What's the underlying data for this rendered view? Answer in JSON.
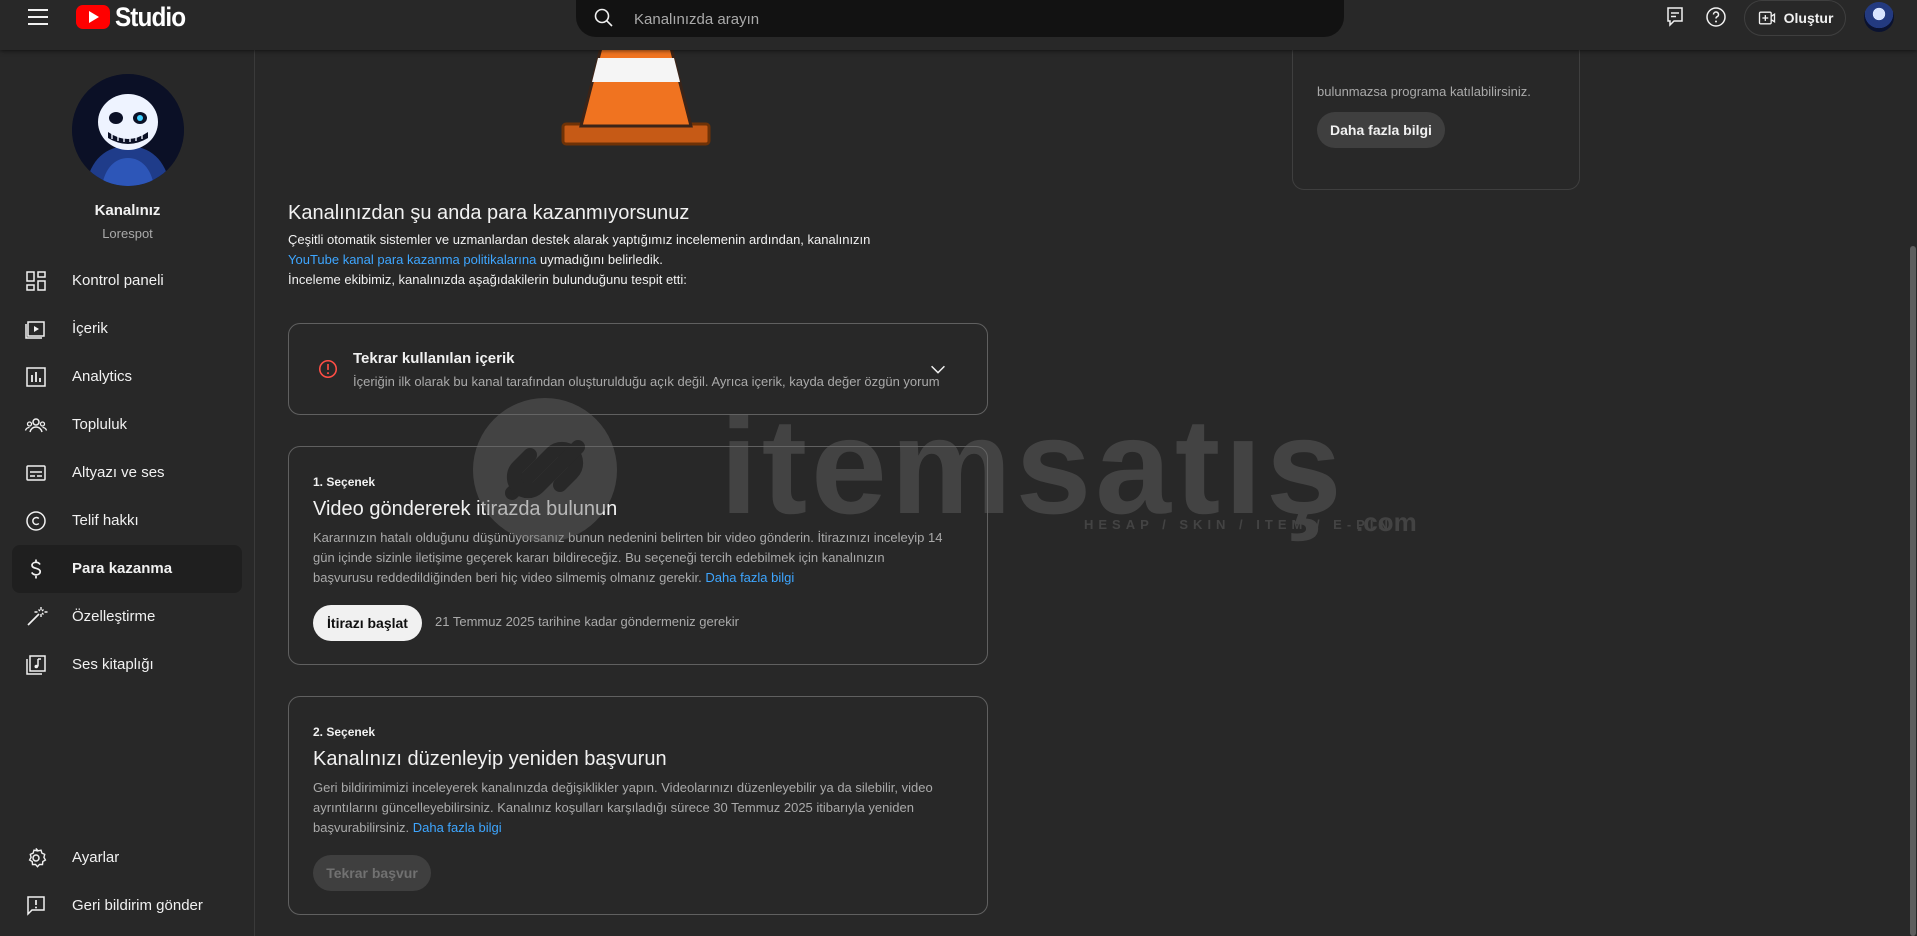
{
  "header": {
    "logo_text": "Studio",
    "search_placeholder": "Kanalınızda arayın",
    "create_label": "Oluştur"
  },
  "sidebar": {
    "channel_name": "Kanalınız",
    "channel_handle": "Lorespot",
    "items": [
      {
        "label": "Kontrol paneli",
        "icon": "dashboard-icon"
      },
      {
        "label": "İçerik",
        "icon": "content-icon"
      },
      {
        "label": "Analytics",
        "icon": "analytics-icon"
      },
      {
        "label": "Topluluk",
        "icon": "community-icon"
      },
      {
        "label": "Altyazı ve ses",
        "icon": "subtitles-icon"
      },
      {
        "label": "Telif hakkı",
        "icon": "copyright-icon"
      },
      {
        "label": "Para kazanma",
        "icon": "dollar-icon",
        "active": true
      },
      {
        "label": "Özelleştirme",
        "icon": "magic-wand-icon"
      },
      {
        "label": "Ses kitaplığı",
        "icon": "audio-library-icon"
      }
    ],
    "bottom_items": [
      {
        "label": "Ayarlar",
        "icon": "gear-icon"
      },
      {
        "label": "Geri bildirim gönder",
        "icon": "feedback-icon"
      }
    ]
  },
  "side_card": {
    "text": "bulunmazsa programa katılabilirsiniz.",
    "button_label": "Daha fazla bilgi"
  },
  "main": {
    "heading": "Kanalınızdan şu anda para kazanmıyorsunuz",
    "intro_line1": "Çeşitli otomatik sistemler ve uzmanlardan destek alarak yaptığımız incelemenin ardından, kanalınızın",
    "intro_link": "YouTube kanal para kazanma politikalarına",
    "intro_line2_rest": " uymadığını belirledik.",
    "intro_line3": "İnceleme ekibimiz, kanalınızda aşağıdakilerin bulunduğunu tespit etti:",
    "reason": {
      "title": "Tekrar kullanılan içerik",
      "description": "İçeriğin ilk olarak bu kanal tarafından oluşturulduğu açık değil. Ayrıca içerik, kayda değer özgün yorum"
    },
    "option1": {
      "label": "1. Seçenek",
      "title": "Video göndererek itirazda bulunun",
      "description": "Kararınızın hatalı olduğunu düşünüyorsanız bunun nedenini belirten bir video gönderin. İtirazınızı inceleyip 14 gün içinde sizinle iletişime geçerek kararı bildireceğiz. Bu seçeneği tercih edebilmek için kanalınızın başvurusu reddedildiğinden beri hiç video silmemiş olmanız gerekir.",
      "link": "Daha fazla bilgi",
      "button_label": "İtirazı başlat",
      "deadline": "21 Temmuz 2025 tarihine kadar göndermeniz gerekir"
    },
    "option2": {
      "label": "2. Seçenek",
      "title": "Kanalınızı düzenleyip yeniden başvurun",
      "description": "Geri bildirimimizi inceleyerek kanalınızda değişiklikler yapın. Videolarınızı düzenleyebilir ya da silebilir, video ayrıntılarını güncelleyebilirsiniz. Kanalınız koşulları karşıladığı sürece 30 Temmuz 2025 itibarıyla yeniden başvurabilirsiniz.",
      "link": "Daha fazla bilgi",
      "button_label": "Tekrar başvur"
    }
  },
  "watermark": {
    "word": "itemsatış",
    "tagline": "HESAP / SKIN / ITEM / E-PIN",
    "suffix": ".com"
  },
  "colors": {
    "background": "#282828",
    "accent_link": "#3ea6ff",
    "brand_red": "#ff0000"
  }
}
